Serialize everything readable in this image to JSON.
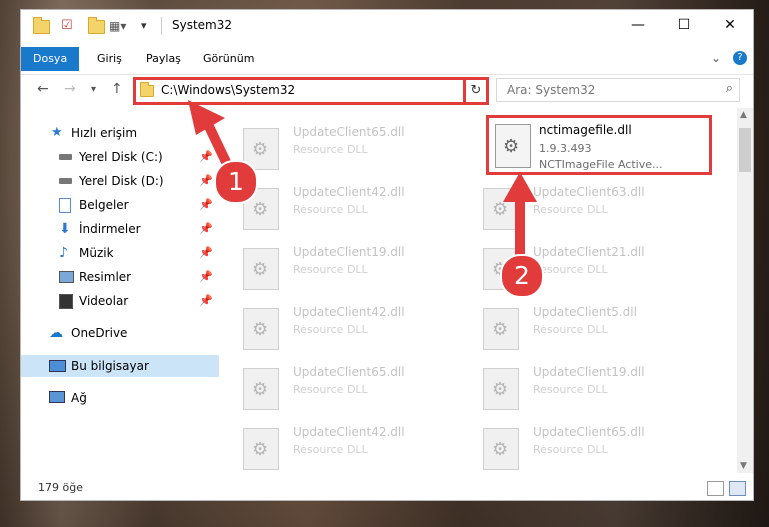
{
  "window": {
    "title": "System32",
    "ribbon_tabs": [
      "Dosya",
      "Giriş",
      "Paylaş",
      "Görünüm"
    ],
    "address": "C:\\Windows\\System32",
    "search_placeholder": "Ara: System32"
  },
  "sidebar": {
    "items": [
      {
        "label": "Hızlı erişim"
      },
      {
        "label": "Yerel Disk (C:)"
      },
      {
        "label": "Yerel Disk (D:)"
      },
      {
        "label": "Belgeler"
      },
      {
        "label": "İndirmeler"
      },
      {
        "label": "Müzik"
      },
      {
        "label": "Resimler"
      },
      {
        "label": "Videolar"
      },
      {
        "label": "OneDrive"
      },
      {
        "label": "Bu bilgisayar"
      },
      {
        "label": "Ağ"
      }
    ]
  },
  "files": [
    {
      "name": "UpdateClient65.dll",
      "type": "Resource DLL"
    },
    {
      "name": "UpdateClient42.dll",
      "type": "Resource DLL"
    },
    {
      "name": "UpdateClient63.dll",
      "type": "Resource DLL"
    },
    {
      "name": "UpdateClient19.dll",
      "type": "Resource DLL"
    },
    {
      "name": "UpdateClient21.dll",
      "type": "Resource DLL"
    },
    {
      "name": "UpdateClient42.dll",
      "type": "Resource DLL"
    },
    {
      "name": "UpdateClient5.dll",
      "type": "Resource DLL"
    },
    {
      "name": "UpdateClient65.dll",
      "type": "Resource DLL"
    },
    {
      "name": "UpdateClient19.dll",
      "type": "Resource DLL"
    },
    {
      "name": "UpdateClient42.dll",
      "type": "Resource DLL"
    },
    {
      "name": "UpdateClient65.dll",
      "type": "Resource DLL"
    }
  ],
  "highlighted_file": {
    "name": "nctimagefile.dll",
    "version": "1.9.3.493",
    "description": "NCTImageFile Active..."
  },
  "status": {
    "item_count": "179 öğe"
  },
  "annotations": {
    "badge_1": "1",
    "badge_2": "2",
    "color": "#e23b3b"
  }
}
